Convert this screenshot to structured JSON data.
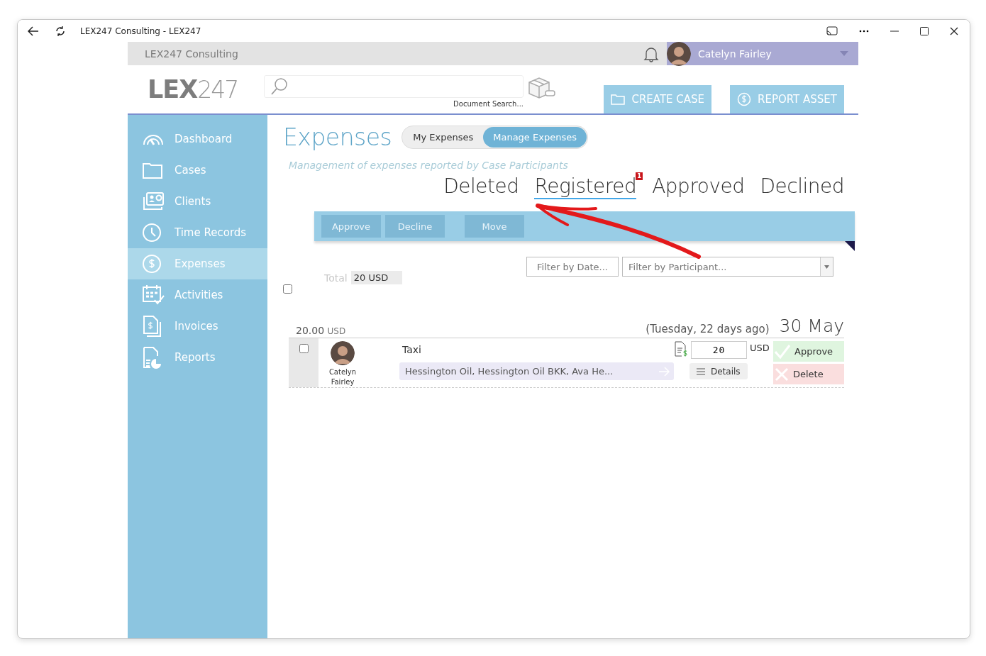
{
  "window": {
    "title": "LEX247 Consulting - LEX247"
  },
  "topbar": {
    "company": "LEX247 Consulting",
    "user": "Catelyn Fairley"
  },
  "header": {
    "logo_bold": "LEX",
    "logo_light": "247",
    "search_caption": "Document Search...",
    "buttons": [
      {
        "label": "CREATE CASE",
        "kind": "folder"
      },
      {
        "label": "REPORT ASSET",
        "kind": "dollar"
      }
    ]
  },
  "sidebar": {
    "items": [
      {
        "label": "Dashboard",
        "kind": "gauge",
        "selected": false
      },
      {
        "label": "Cases",
        "kind": "folder",
        "selected": false
      },
      {
        "label": "Clients",
        "kind": "contacts",
        "selected": false
      },
      {
        "label": "Time Records",
        "kind": "clock",
        "selected": false
      },
      {
        "label": "Expenses",
        "kind": "dollar",
        "selected": true
      },
      {
        "label": "Activities",
        "kind": "calendar",
        "selected": false
      },
      {
        "label": "Invoices",
        "kind": "invoice",
        "selected": false
      },
      {
        "label": "Reports",
        "kind": "report",
        "selected": false
      }
    ]
  },
  "page": {
    "title": "Expenses",
    "toggle": [
      {
        "label": "My Expenses",
        "selected": false
      },
      {
        "label": "Manage Expenses",
        "selected": true
      }
    ],
    "subtitle": "Management of expenses reported by Case Participants",
    "status_tabs": [
      {
        "label": "Deleted",
        "selected": false
      },
      {
        "label": "Registered",
        "selected": true,
        "badge": "1"
      },
      {
        "label": "Approved",
        "selected": false
      },
      {
        "label": "Declined",
        "selected": false
      }
    ],
    "actions": [
      {
        "label": "Approve",
        "disabled": true
      },
      {
        "label": "Decline",
        "disabled": true
      },
      {
        "label": "Move",
        "disabled": true
      }
    ],
    "filters": {
      "date": "Filter by Date...",
      "participant": "Filter by Participant..."
    },
    "total": {
      "label": "Total",
      "value": "20 USD"
    },
    "select_all": {
      "checked": false
    },
    "group": {
      "amount": "20.00",
      "currency": "USD",
      "day": "(Tuesday, 22 days ago)",
      "date": "30 May"
    },
    "expenses": [
      {
        "checked": false,
        "person": "Catelyn Fairley",
        "title": "Taxi",
        "cases": "Hessington Oil, Hessington Oil BKK, Ava He...",
        "amount": "20",
        "currency": "USD",
        "details": "Details",
        "approve": "Approve",
        "delete": "Delete"
      }
    ]
  }
}
